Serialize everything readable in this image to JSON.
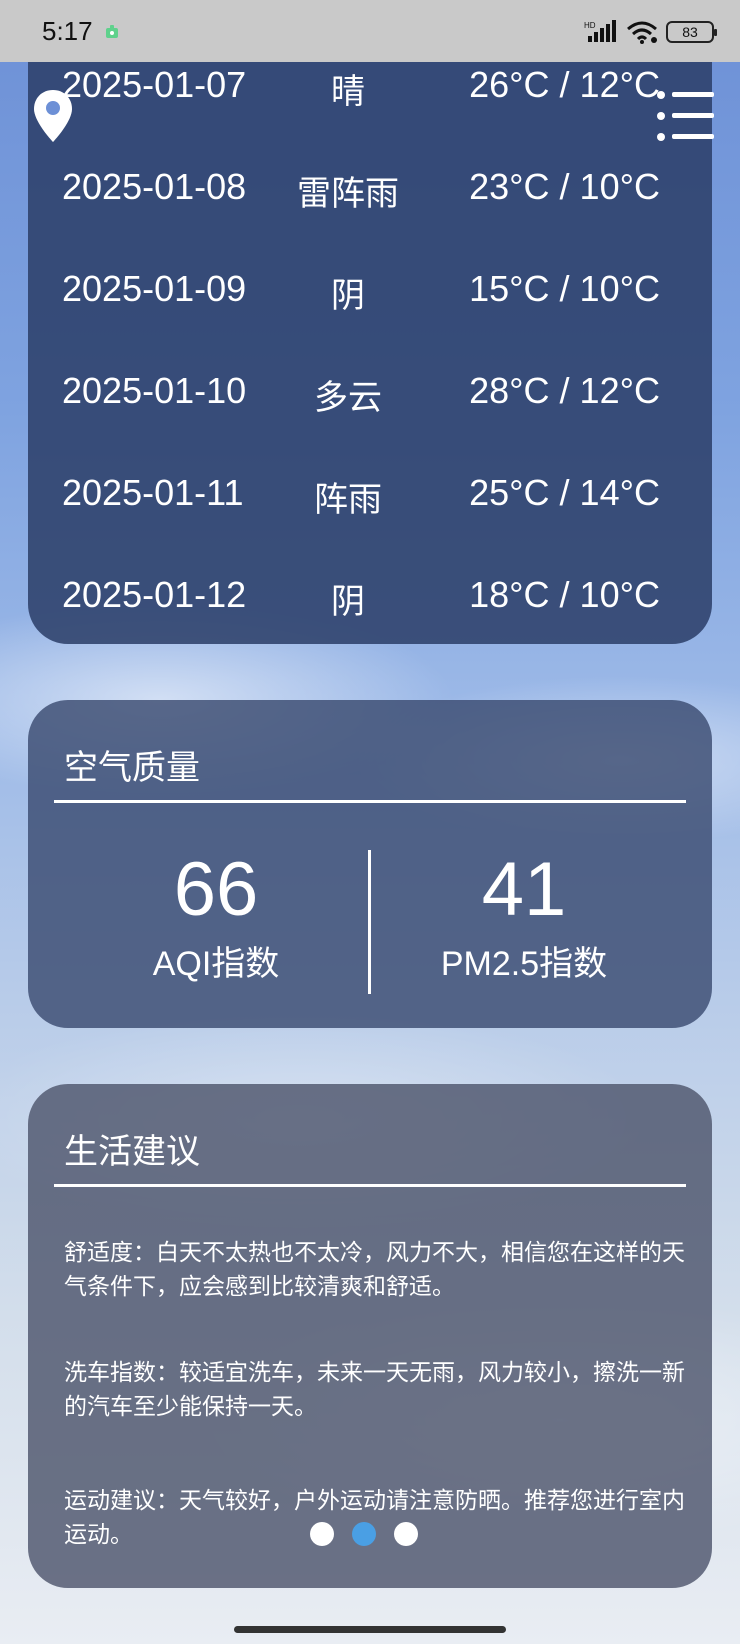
{
  "status_bar": {
    "time": "5:17",
    "network": "HD",
    "battery": "83"
  },
  "forecast": [
    {
      "date": "2025-01-07",
      "condition": "晴",
      "temp": "26°C / 12°C"
    },
    {
      "date": "2025-01-08",
      "condition": "雷阵雨",
      "temp": "23°C / 10°C"
    },
    {
      "date": "2025-01-09",
      "condition": "阴",
      "temp": "15°C / 10°C"
    },
    {
      "date": "2025-01-10",
      "condition": "多云",
      "temp": "28°C / 12°C"
    },
    {
      "date": "2025-01-11",
      "condition": "阵雨",
      "temp": "25°C / 14°C"
    },
    {
      "date": "2025-01-12",
      "condition": "阴",
      "temp": "18°C / 10°C"
    }
  ],
  "air_quality": {
    "title": "空气质量",
    "aqi_value": "66",
    "aqi_label": "AQI指数",
    "pm25_value": "41",
    "pm25_label": "PM2.5指数"
  },
  "life_advice": {
    "title": "生活建议",
    "comfort": "舒适度：白天不太热也不太冷，风力不大，相信您在这样的天气条件下，应会感到比较清爽和舒适。",
    "car_wash": "洗车指数：较适宜洗车，未来一天无雨，风力较小，擦洗一新的汽车至少能保持一天。",
    "sport": "运动建议：天气较好，户外运动请注意防晒。推荐您进行室内运动。"
  },
  "pager": {
    "count": 3,
    "active_index": 1
  },
  "icons": {
    "location": "location-pin-icon",
    "menu": "menu-list-icon"
  },
  "colors": {
    "active_dot": "#4a9fe4"
  }
}
